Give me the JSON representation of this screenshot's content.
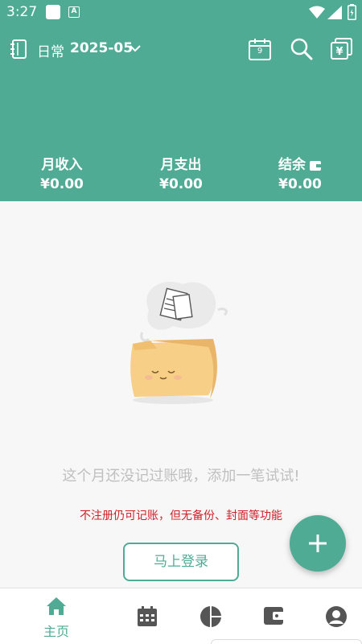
{
  "status_bar": {
    "time": "3:27",
    "a_badge": "A"
  },
  "header": {
    "book_name": "日常",
    "month": "2025-05",
    "calendar_day": "9",
    "summary": [
      {
        "label": "月收入",
        "value": "¥0.00"
      },
      {
        "label": "月支出",
        "value": "¥0.00"
      },
      {
        "label": "结余",
        "value": "¥0.00"
      }
    ]
  },
  "content": {
    "empty_message": "这个月还没记过账哦，添加一笔试试!",
    "warning": "不注册仍可记账，但无备份、封面等功能",
    "login_button": "马上登录"
  },
  "nav": {
    "items": [
      {
        "label": "主页",
        "icon": "home-icon"
      },
      {
        "icon": "calendar-icon"
      },
      {
        "icon": "pie-chart-icon"
      },
      {
        "icon": "wallet-icon"
      },
      {
        "icon": "user-icon"
      }
    ]
  },
  "colors": {
    "accent": "#4fab94",
    "warning": "#d0202a",
    "muted_text": "#bfbfbf"
  }
}
